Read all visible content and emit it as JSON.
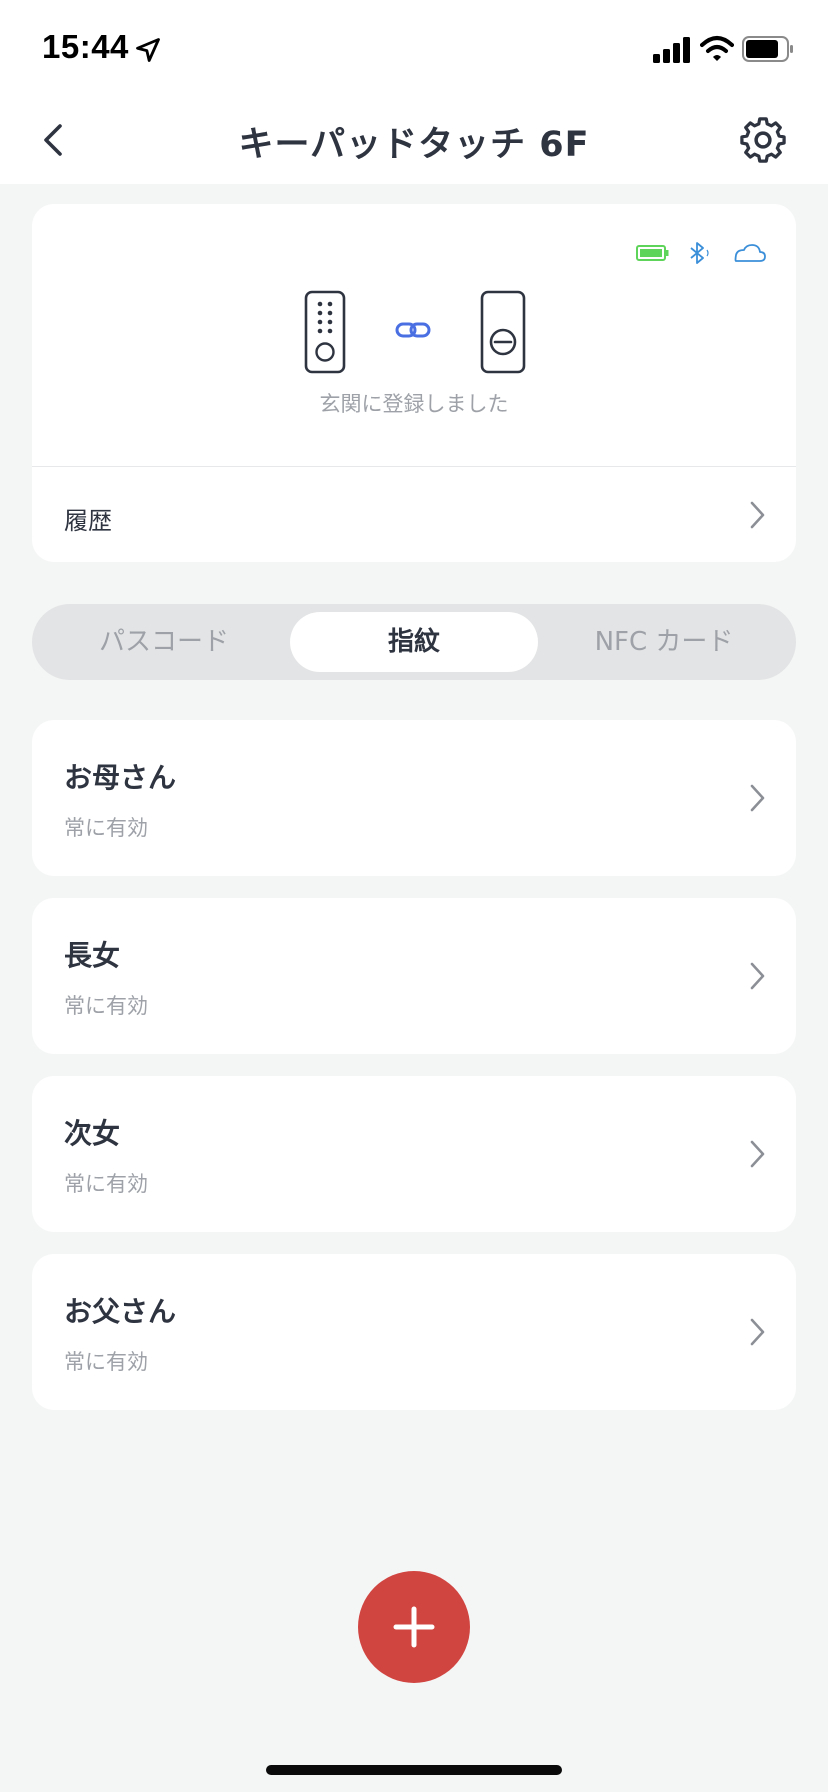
{
  "status_bar": {
    "time": "15:44",
    "icons": [
      "location-arrow-icon",
      "cellular-signal-icon",
      "wifi-icon",
      "battery-icon"
    ]
  },
  "header": {
    "title": "キーパッドタッチ 6F",
    "back_icon": "chevron-left-icon",
    "settings_icon": "gear-icon"
  },
  "device_card": {
    "status_icons": [
      "battery-full-icon",
      "bluetooth-icon",
      "cloud-icon"
    ],
    "status_colors": {
      "battery": "#5fd45a",
      "bluetooth": "#3b8fd9",
      "cloud": "#3b8fd9"
    },
    "link_color": "#4a6fe3",
    "caption": "玄関に登録しました",
    "history_label": "履歴"
  },
  "tabs": [
    {
      "label": "パスコード",
      "active": false
    },
    {
      "label": "指紋",
      "active": true
    },
    {
      "label": "NFC カード",
      "active": false
    }
  ],
  "entries": [
    {
      "name": "お母さん",
      "status": "常に有効"
    },
    {
      "name": "長女",
      "status": "常に有効"
    },
    {
      "name": "次女",
      "status": "常に有効"
    },
    {
      "name": "お父さん",
      "status": "常に有効"
    }
  ],
  "fab": {
    "icon": "plus-icon",
    "color": "#d14541"
  }
}
